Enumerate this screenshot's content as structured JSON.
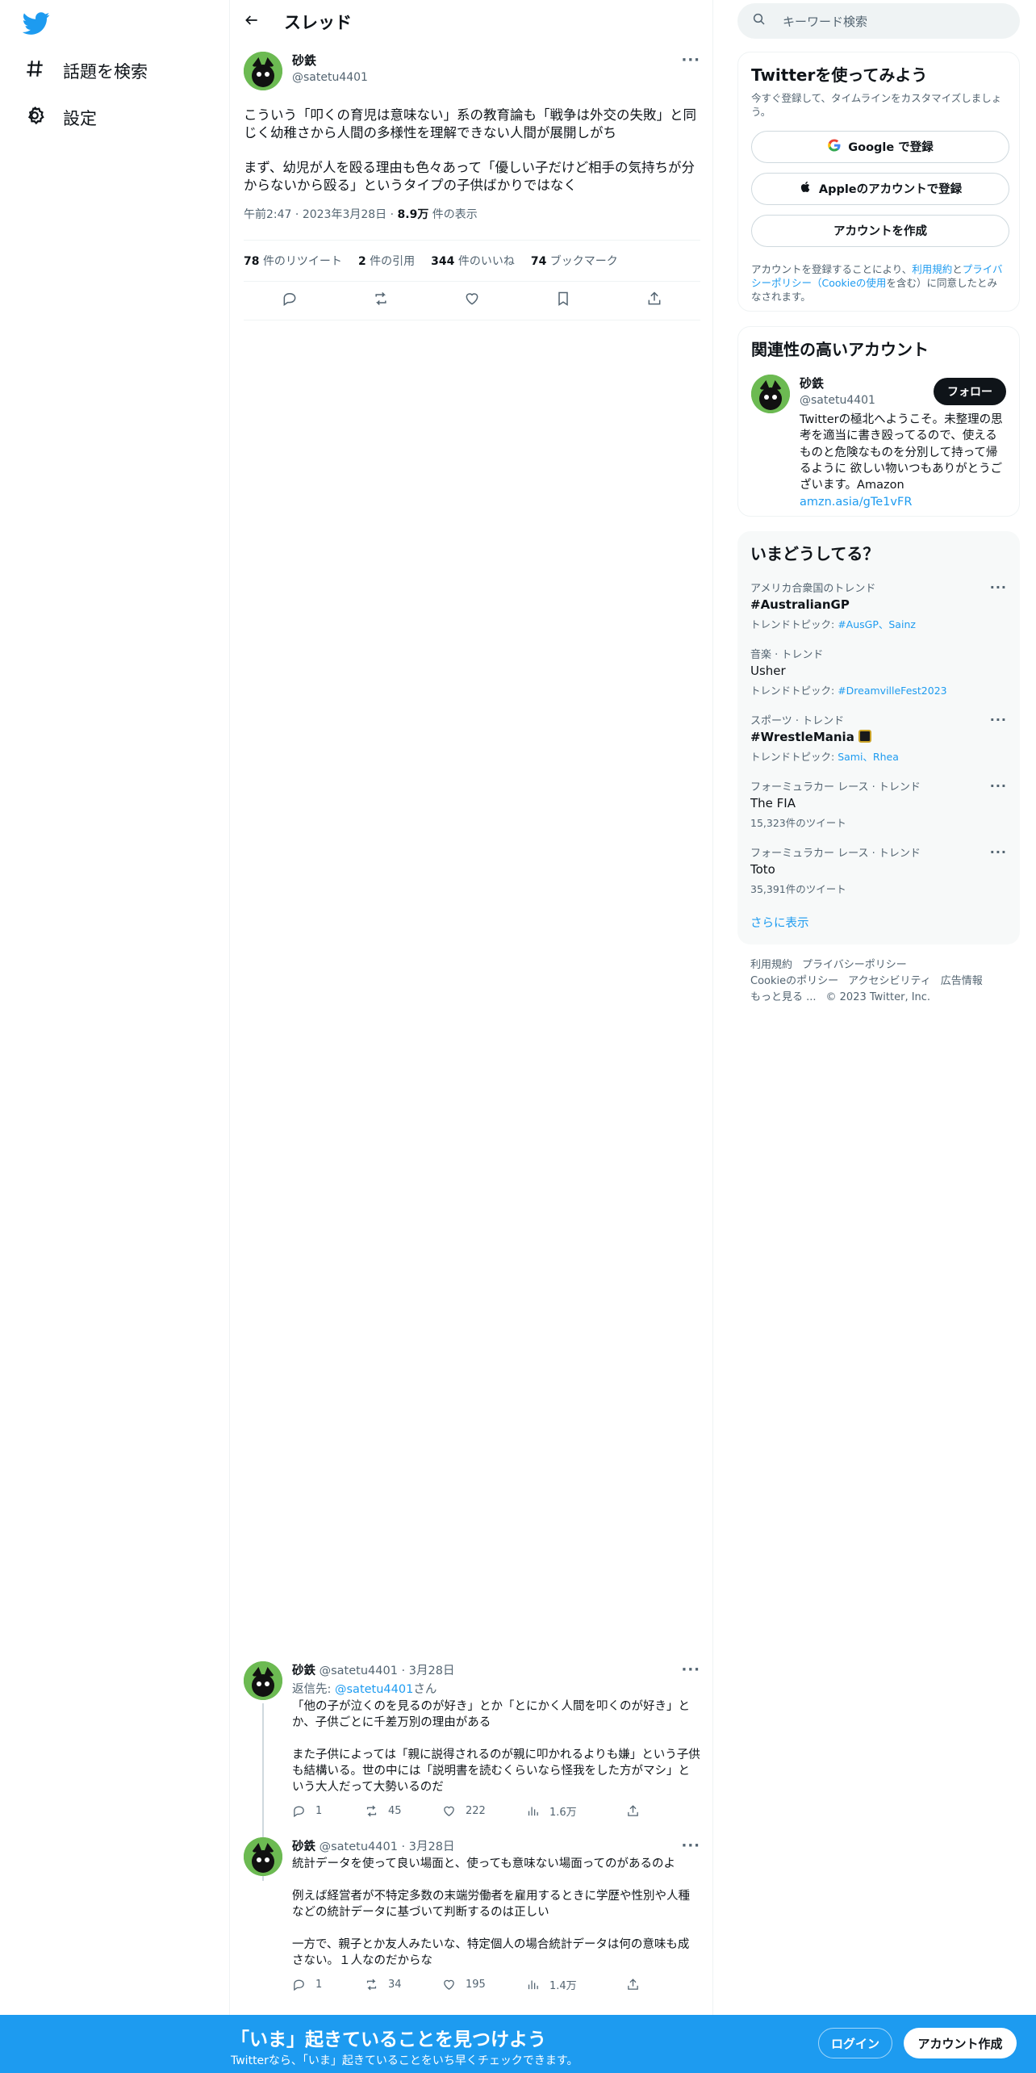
{
  "nav": {
    "explore": "話題を検索",
    "settings": "設定"
  },
  "header": {
    "title": "スレッド"
  },
  "tweet": {
    "name": "砂鉄",
    "handle": "@satetu4401",
    "text": "こういう「叩くの育児は意味ない」系の教育論も「戦争は外交の失敗」と同じく幼稚さから人間の多様性を理解できない人間が展開しがち\n\nまず、幼児が人を殴る理由も色々あって「優しい子だけど相手の気持ちが分からないから殴る」というタイプの子供ばかりではなく",
    "time": "午前2:47",
    "date": "2023年3月28日",
    "views_count": "8.9万",
    "views_label": "件の表示",
    "retweets": "78",
    "retweets_label": "件のリツイート",
    "quotes": "2",
    "quotes_label": "件の引用",
    "likes": "344",
    "likes_label": "件のいいね",
    "bookmarks": "74",
    "bookmarks_label": "ブックマーク"
  },
  "replies": [
    {
      "name": "砂鉄",
      "handle": "@satetu4401",
      "date": "3月28日",
      "reply_to_label": "返信先:",
      "reply_to_handle": "@satetu4401",
      "reply_to_suffix": "さん",
      "text": "「他の子が泣くのを見るのが好き」とか「とにかく人間を叩くのが好き」とか、子供ごとに千差万別の理由がある\n\nまた子供によっては「親に説得されるのが親に叩かれるよりも嫌」という子供も結構いる。世の中には「説明書を読むくらいなら怪我をした方がマシ」という大人だって大勢いるのだ",
      "replies": "1",
      "retweets": "45",
      "likes": "222",
      "views": "1.6万"
    },
    {
      "name": "砂鉄",
      "handle": "@satetu4401",
      "date": "3月28日",
      "text": "統計データを使って良い場面と、使っても意味ない場面ってのがあるのよ\n\n例えば経営者が不特定多数の末端労働者を雇用するときに学歴や性別や人種などの統計データに基づいて判断するのは正しい\n\n一方で、親子とか友人みたいな、特定個人の場合統計データは何の意味も成さない。１人なのだからな",
      "replies": "1",
      "retweets": "34",
      "likes": "195",
      "views": "1.4万"
    }
  ],
  "search": {
    "placeholder": "キーワード検索"
  },
  "signup_card": {
    "title": "Twitterを使ってみよう",
    "subtitle": "今すぐ登録して、タイムラインをカスタマイズしましょう。",
    "google": "Google で登録",
    "apple": "Appleのアカウントで登録",
    "create": "アカウントを作成",
    "legal_pre": "アカウントを登録することにより、",
    "legal_terms": "利用規約",
    "legal_and": "と",
    "legal_privacy": "プライバシーポリシー（Cookieの使用",
    "legal_post": "を含む）に同意したとみなされます。"
  },
  "relevant": {
    "title": "関連性の高いアカウント",
    "name": "砂鉄",
    "handle": "@satetu4401",
    "follow": "フォロー",
    "bio": "Twitterの極北へようこそ。未整理の思考を適当に書き殴ってるので、使えるものと危険なものを分別して持って帰るように 欲しい物いつもありがとうございます。Amazon",
    "link": "amzn.asia/gTe1vFR"
  },
  "trends": {
    "title": "いまどうしてる？",
    "items": [
      {
        "context": "アメリカ合衆国のトレンド",
        "name": "#AustralianGP",
        "sub_label": "トレンドトピック: ",
        "sub_link": "#AusGP、Sainz"
      },
      {
        "context": "音楽 · トレンド",
        "name": "Usher",
        "sub_label": "トレンドトピック: ",
        "sub_link": "#DreamvilleFest2023"
      },
      {
        "context": "スポーツ · トレンド",
        "name": "#WrestleMania",
        "sub_label": "トレンドトピック: ",
        "sub_link": "Sami、Rhea"
      },
      {
        "context": "フォーミュラカー レース · トレンド",
        "name": "The FIA",
        "sub_label": "15,323件のツイート",
        "sub_link": ""
      },
      {
        "context": "フォーミュラカー レース · トレンド",
        "name": "Toto",
        "sub_label": "35,391件のツイート",
        "sub_link": ""
      }
    ],
    "show_more": "さらに表示"
  },
  "footer": {
    "terms": "利用規約",
    "privacy": "プライバシーポリシー",
    "cookie": "Cookieのポリシー",
    "accessibility": "アクセシビリティ",
    "ads": "広告情報",
    "more": "もっと見る ...",
    "copyright": "© 2023 Twitter, Inc."
  },
  "bottom_bar": {
    "title": "「いま」起きていることを見つけよう",
    "subtitle": "Twitterなら、「いま」起きていることをいち早くチェックできます。",
    "login": "ログイン",
    "signup": "アカウント作成"
  },
  "colors": {
    "accent": "#1d9bf0",
    "text": "#0f1419",
    "muted": "#536471"
  }
}
